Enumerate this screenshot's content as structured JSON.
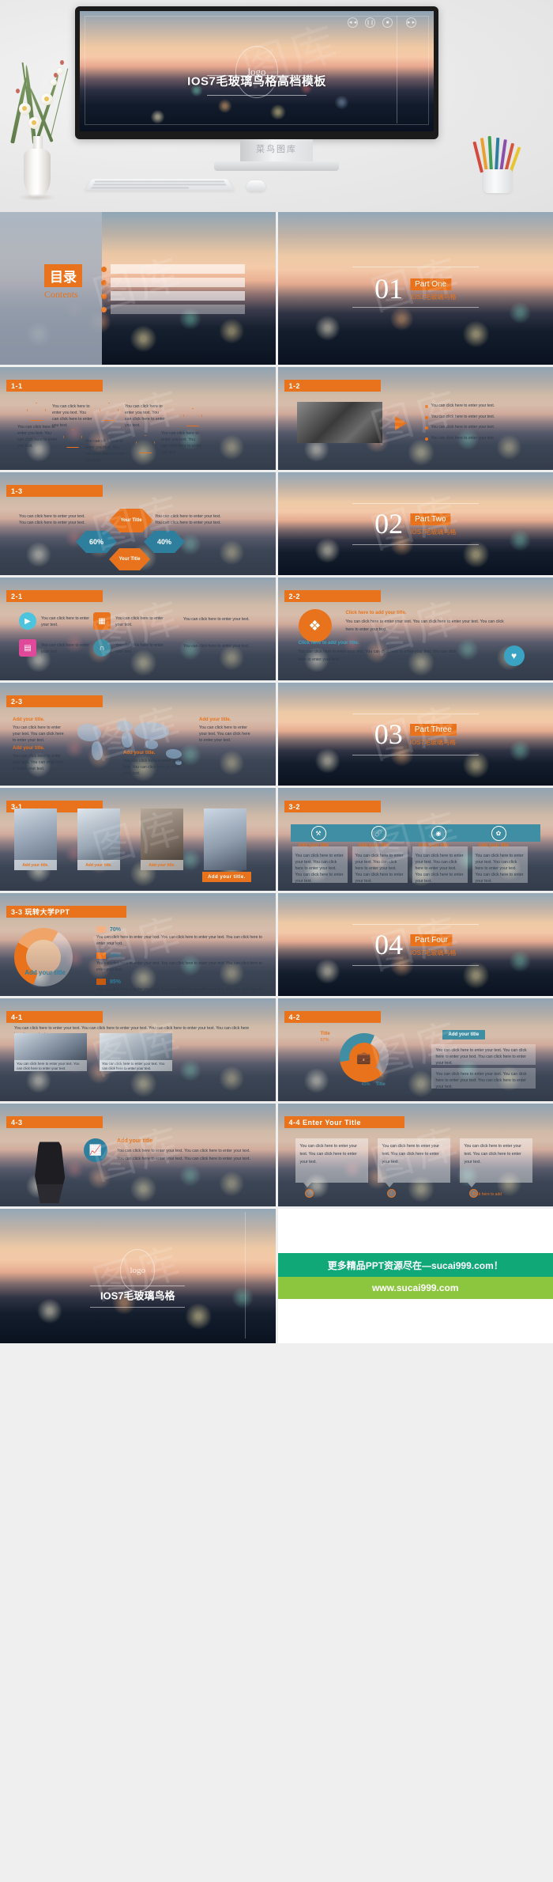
{
  "hero": {
    "screen_logo": "logo",
    "screen_title": "IOS7毛玻璃鸟格高档模板",
    "stand_label": "菜鸟图库",
    "watermark": "图库"
  },
  "slides": {
    "contents": {
      "cn": "目录",
      "en": "Contents",
      "bars": [
        "",
        "",
        "",
        ""
      ]
    },
    "section_01": {
      "num": "01",
      "label": "Part One",
      "sub": "IOS7毛玻璃鸟格"
    },
    "section_02": {
      "num": "02",
      "label": "Part Two",
      "sub": "IOS7毛玻璃鸟格"
    },
    "section_03": {
      "num": "03",
      "label": "Part Three",
      "sub": "IOS7毛玻璃鸟格"
    },
    "section_04": {
      "num": "04",
      "label": "Part Four",
      "sub": "IOS7毛玻璃鸟格"
    },
    "s11": {
      "tag": "1-1",
      "texts": [
        "You can click here to enter you text. You can click here to enter you text.",
        "You can click here to enter you text. You can click here to enter you text.",
        "You can click here to enter you text. You can click here to enter you text.",
        "You can click here to enter you text. You can click here to enter you text.",
        "You can click here to enter you text. You can click here to enter you text."
      ]
    },
    "s12": {
      "tag": "1-2",
      "bullets": [
        "You can click here to enter your text.",
        "You can click here to enter your text.",
        "You can click here to enter your text.",
        "You can click here to enter your text."
      ]
    },
    "s13": {
      "tag": "1-3",
      "left_text": "You can click here to enter your text. You can click here to enter your text.",
      "right_text": "You can click here to enter your text. You can click here to enter your text.",
      "hex_title_top": "Your Title",
      "hex_title_bottom": "Your Title",
      "pct_left": "60%",
      "pct_right": "40%"
    },
    "s21": {
      "tag": "2-1",
      "items": [
        "You can click here to enter your text.",
        "You can click here to enter your text.",
        "You can click here to enter your text.",
        "You can click here to enter your text.",
        "You can click here to enter your text.",
        "You can click here to enter your text."
      ]
    },
    "s22": {
      "tag": "2-2",
      "title_1": "Click here to add your title.",
      "body_1": "You can click here to enter your text. You can click here to enter your text. You can click here to enter your text.",
      "title_2": "Click here to add your title.",
      "body_2": "You can click here to enter your text. You can click here to enter your text. You can click here to enter your text."
    },
    "s23": {
      "tag": "2-3",
      "headings": [
        "Add your title.",
        "Add your title.",
        "Add your title.",
        "Add your title."
      ],
      "body": "You can click here to enter your text. You can click here to enter your text."
    },
    "s31": {
      "tag": "3-1",
      "captions": [
        "Add your title.",
        "Add your title.",
        "Add your title.",
        "Add your title."
      ]
    },
    "s32": {
      "tag": "3-2",
      "headings": [
        "Add your title",
        "Add your title",
        "Add your title",
        "Add your title"
      ],
      "body": "You can click here to enter your text. You can click here to enter your text. You can click here to enter your text."
    },
    "s33": {
      "tag": "3-3 玩转大学PPT",
      "donut_label": "Add your title",
      "legend": [
        {
          "pct": "70%",
          "text": "You can click here to enter your text. You can click here to enter your text. You can click here to enter your text."
        },
        {
          "pct": "55%",
          "text": "You can click here to enter your text. You can click here to enter your text. You can click here to enter your text."
        },
        {
          "pct": "85%",
          "text": "You can click here to enter your text. You can click here to enter your text. You can click here to enter your text."
        }
      ]
    },
    "s41": {
      "tag": "4-1",
      "top_text": "You can click here to enter your text. You can click here to enter your text. You can click here to enter your text. You can click here to enter your text.",
      "captions": [
        "You can click here to enter your text. You can click here to enter your text.",
        "You can click here to enter your text. You can click here to enter your text."
      ]
    },
    "s42": {
      "tag": "4-2",
      "pill": "Add your title",
      "ring_left_label": "Title",
      "ring_left_pct": "57%",
      "ring_bottom_pct": "43%",
      "ring_bottom_label": "Title",
      "body": "You can click here to enter your text. You can click here to enter your text. You can click here to enter your text."
    },
    "s43": {
      "tag": "4-3",
      "title": "Add your title",
      "body": "You can click here to enter your text. You can click here to enter your text. You can click here to enter your text. You can click here to enter your text."
    },
    "s44": {
      "tag": "4-4 Enter  Your  Title",
      "cards": [
        "You can click here to enter your text. You can click here to enter your text.",
        "You can click here to enter your text. You can click here to enter your text.",
        "You can click here to enter your text. You can click here to enter your text."
      ],
      "numbers": [
        "1",
        "2",
        "3"
      ],
      "footer": "Click here to add"
    },
    "end": {
      "logo": "logo",
      "title": "IOS7毛玻璃鸟格"
    }
  },
  "promo": {
    "line1": "更多精品PPT资源尽在—sucai999.com！",
    "line2": "www.sucai999.com"
  },
  "colors": {
    "orange": "#e8731c",
    "teal": "#3f8ea3",
    "blue": "#2e7f9e",
    "green_dark": "#11a877",
    "green_light": "#8cc63e"
  }
}
